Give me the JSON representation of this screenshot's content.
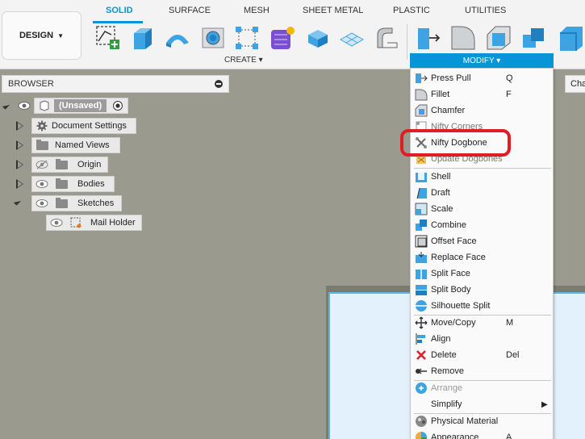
{
  "toolbar": {
    "workspace_label": "DESIGN",
    "tabs": [
      "SOLID",
      "SURFACE",
      "MESH",
      "SHEET METAL",
      "PLASTIC",
      "UTILITIES"
    ],
    "active_tab": "SOLID",
    "create_label": "CREATE ▾",
    "modify_label": "MODIFY ▾"
  },
  "browser": {
    "title": "BROWSER",
    "root_label": "(Unsaved)",
    "items": [
      {
        "label": "Document Settings"
      },
      {
        "label": "Named Views"
      },
      {
        "label": "Origin"
      },
      {
        "label": "Bodies"
      },
      {
        "label": "Sketches"
      },
      {
        "label": "Mail Holder"
      }
    ]
  },
  "canvas": {
    "side_tab": "Cha"
  },
  "modify_menu": {
    "items": [
      {
        "label": "Press Pull",
        "shortcut": "Q",
        "icon": "press-pull-icon"
      },
      {
        "label": "Fillet",
        "shortcut": "F",
        "icon": "fillet-icon"
      },
      {
        "label": "Chamfer",
        "shortcut": "",
        "icon": "chamfer-icon"
      },
      {
        "label": "Nifty Corners",
        "shortcut": "",
        "icon": "nifty-corners-icon"
      },
      {
        "label": "Nifty Dogbone",
        "shortcut": "",
        "icon": "nifty-dogbone-icon"
      },
      {
        "label": "Update Dogbones",
        "shortcut": "",
        "icon": "update-dogbones-icon"
      },
      {
        "label": "Shell",
        "shortcut": "",
        "icon": "shell-icon"
      },
      {
        "label": "Draft",
        "shortcut": "",
        "icon": "draft-icon"
      },
      {
        "label": "Scale",
        "shortcut": "",
        "icon": "scale-icon"
      },
      {
        "label": "Combine",
        "shortcut": "",
        "icon": "combine-icon"
      },
      {
        "label": "Offset Face",
        "shortcut": "",
        "icon": "offset-face-icon"
      },
      {
        "label": "Replace Face",
        "shortcut": "",
        "icon": "replace-face-icon"
      },
      {
        "label": "Split Face",
        "shortcut": "",
        "icon": "split-face-icon"
      },
      {
        "label": "Split Body",
        "shortcut": "",
        "icon": "split-body-icon"
      },
      {
        "label": "Silhouette Split",
        "shortcut": "",
        "icon": "silhouette-split-icon"
      },
      {
        "label": "Move/Copy",
        "shortcut": "M",
        "icon": "move-copy-icon"
      },
      {
        "label": "Align",
        "shortcut": "",
        "icon": "align-icon"
      },
      {
        "label": "Delete",
        "shortcut": "Del",
        "icon": "delete-icon"
      },
      {
        "label": "Remove",
        "shortcut": "",
        "icon": "remove-icon"
      },
      {
        "label": "Arrange",
        "shortcut": "",
        "icon": "arrange-icon"
      },
      {
        "label": "Simplify",
        "shortcut": "",
        "icon": "simplify-icon"
      },
      {
        "label": "Physical Material",
        "shortcut": "",
        "icon": "physical-material-icon"
      },
      {
        "label": "Appearance",
        "shortcut": "A",
        "icon": "appearance-icon"
      }
    ]
  },
  "colors": {
    "accent": "#0696d7",
    "highlight_ring": "#e01c24",
    "canvas_bg": "#9b9a8e"
  }
}
